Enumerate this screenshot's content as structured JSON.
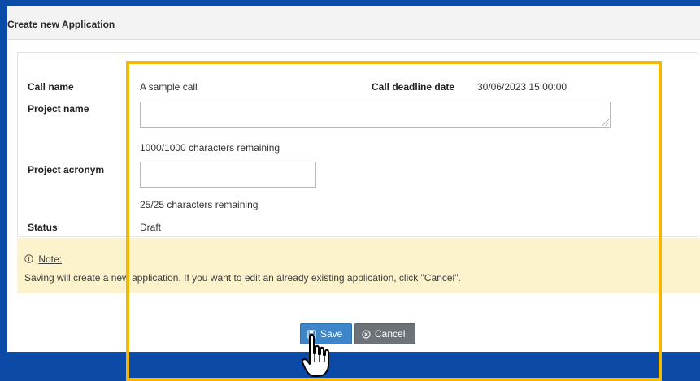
{
  "header": {
    "title": "Create new Application"
  },
  "form": {
    "call_name_label": "Call name",
    "call_name_value": "A sample call",
    "deadline_label": "Call deadline date",
    "deadline_value": "30/06/2023 15:00:00",
    "project_name_label": "Project name",
    "project_name_value": "",
    "project_name_remaining": "1000/1000 characters remaining",
    "project_acronym_label": "Project acronym",
    "project_acronym_value": "",
    "project_acronym_remaining": "25/25 characters remaining",
    "status_label": "Status",
    "status_value": "Draft"
  },
  "note": {
    "title": "Note:",
    "icon": "info-circle-icon",
    "text": "Saving will create a new application. If you want to edit an already existing application, click \"Cancel\"."
  },
  "actions": {
    "save_label": "Save",
    "save_icon": "floppy-disk-icon",
    "cancel_label": "Cancel",
    "cancel_icon": "circle-x-icon"
  },
  "colors": {
    "background": "#0b4aa6",
    "highlight": "#f5b800",
    "note_background": "#fcf2cc",
    "save_button": "#3d86c9",
    "cancel_button": "#6c7278"
  }
}
